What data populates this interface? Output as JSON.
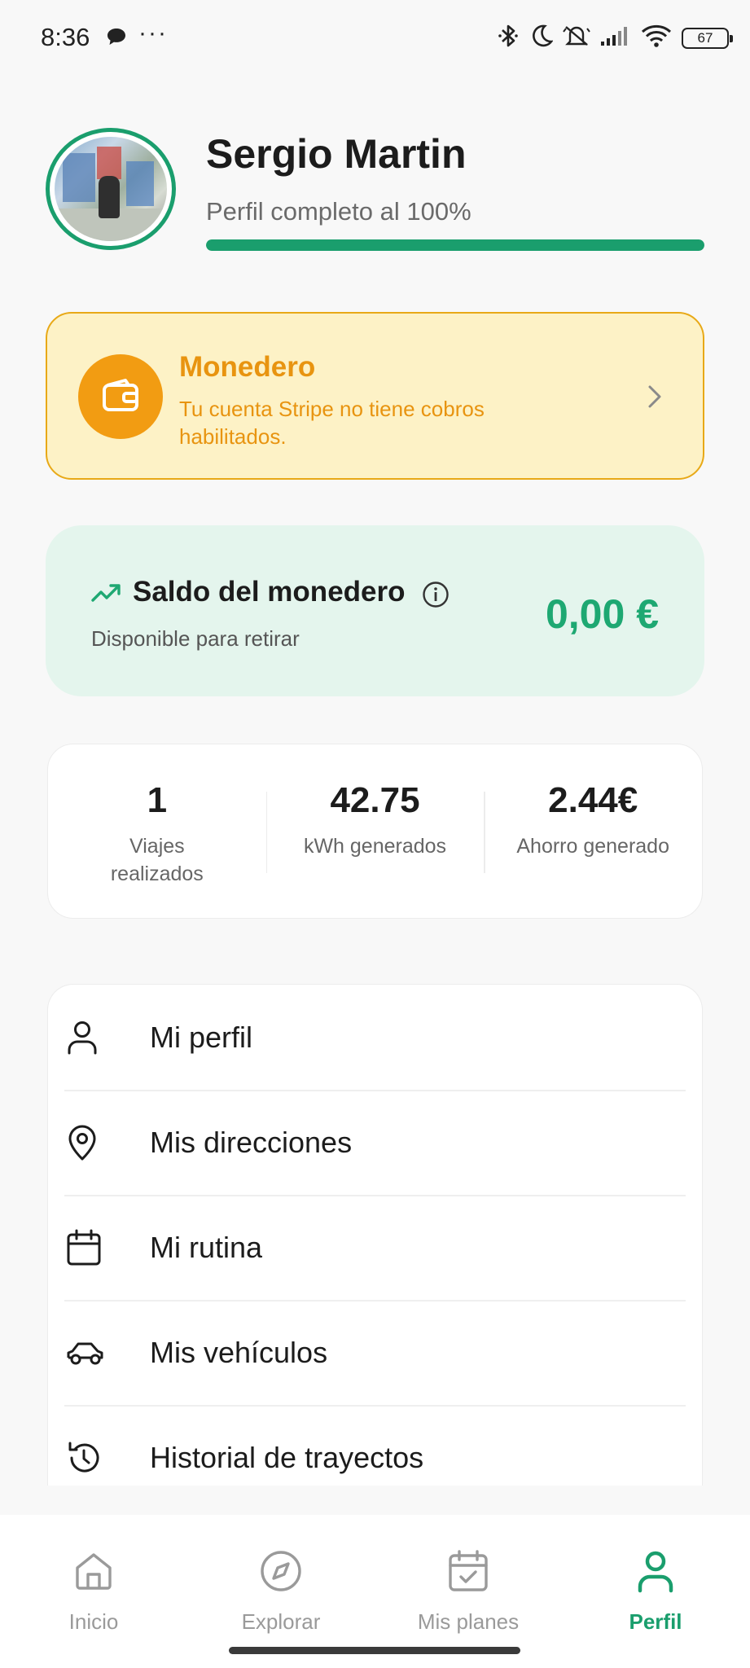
{
  "status_bar": {
    "time": "8:36",
    "dots": "···",
    "battery": "67",
    "icons": [
      "chat-bubble-icon",
      "bluetooth-icon",
      "moon-icon",
      "muted-bell-icon",
      "signal-icon",
      "wifi-icon",
      "battery-icon"
    ]
  },
  "profile": {
    "name": "Sergio Martin",
    "completion_text": "Perfil completo al 100%",
    "completion_fraction": 1.0
  },
  "wallet_alert": {
    "title": "Monedero",
    "description": "Tu cuenta Stripe no tiene cobros habilitados."
  },
  "balance": {
    "title": "Saldo del monedero",
    "subtitle": "Disponible para retirar",
    "amount": "0,00 €"
  },
  "stats": [
    {
      "value": "1",
      "label": "Viajes realizados"
    },
    {
      "value": "42.75",
      "label": "kWh generados"
    },
    {
      "value": "2.44€",
      "label": "Ahorro generado"
    }
  ],
  "menu": [
    {
      "label": "Mi perfil",
      "icon": "user-icon"
    },
    {
      "label": "Mis direcciones",
      "icon": "location-pin-icon"
    },
    {
      "label": "Mi rutina",
      "icon": "calendar-icon"
    },
    {
      "label": "Mis vehículos",
      "icon": "car-icon"
    },
    {
      "label": "Historial de trayectos",
      "icon": "history-icon"
    }
  ],
  "nav": [
    {
      "label": "Inicio",
      "icon": "home-icon",
      "active": false
    },
    {
      "label": "Explorar",
      "icon": "compass-icon",
      "active": false
    },
    {
      "label": "Mis planes",
      "icon": "calendar-check-icon",
      "active": false
    },
    {
      "label": "Perfil",
      "icon": "user-icon",
      "active": true
    }
  ],
  "colors": {
    "accent_green": "#1a9e6d",
    "balance_green": "#1ea872",
    "warning_orange": "#f29c12",
    "warning_bg": "#fdf2c6",
    "balance_bg": "#e4f5ed"
  }
}
